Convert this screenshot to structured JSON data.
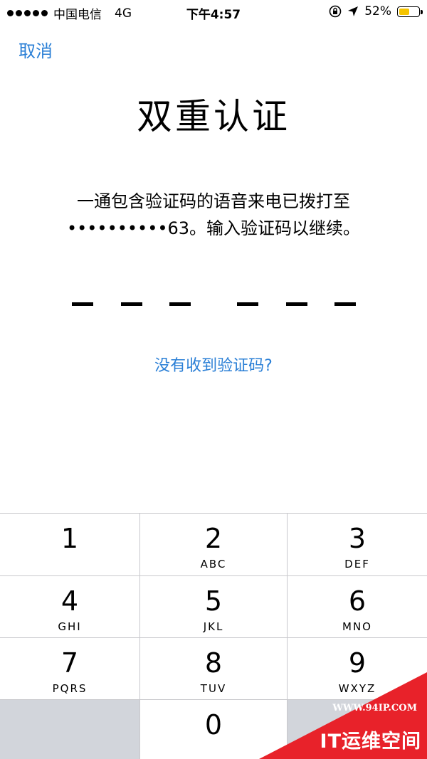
{
  "status_bar": {
    "carrier": "中国电信",
    "network": "4G",
    "time": "下午4:57",
    "battery_percent": "52%",
    "battery_level": 0.52,
    "battery_color": "#f5c400"
  },
  "nav": {
    "cancel_label": "取消"
  },
  "title": "双重认证",
  "message": {
    "line1": "一通包含验证码的语音来电已拨打至",
    "line2": "••••••••••63。输入验证码以继续。"
  },
  "code": {
    "entered": [],
    "length": 6
  },
  "resend_label": "没有收到验证码?",
  "keypad": {
    "keys": [
      {
        "digit": "1",
        "letters": ""
      },
      {
        "digit": "2",
        "letters": "ABC"
      },
      {
        "digit": "3",
        "letters": "DEF"
      },
      {
        "digit": "4",
        "letters": "GHI"
      },
      {
        "digit": "5",
        "letters": "JKL"
      },
      {
        "digit": "6",
        "letters": "MNO"
      },
      {
        "digit": "7",
        "letters": "PQRS"
      },
      {
        "digit": "8",
        "letters": "TUV"
      },
      {
        "digit": "9",
        "letters": "WXYZ"
      },
      {
        "digit": "",
        "letters": ""
      },
      {
        "digit": "0",
        "letters": ""
      },
      {
        "digit": "",
        "letters": ""
      }
    ]
  },
  "watermark": {
    "url": "WWW.94IP.COM",
    "brand": "IT运维空间",
    "color": "#e8222a"
  },
  "colors": {
    "accent": "#2a7fd6",
    "keypad_blank": "#d2d5db"
  },
  "icons": [
    "signal-dots-icon",
    "orientation-lock-icon",
    "location-arrow-icon",
    "battery-icon"
  ]
}
